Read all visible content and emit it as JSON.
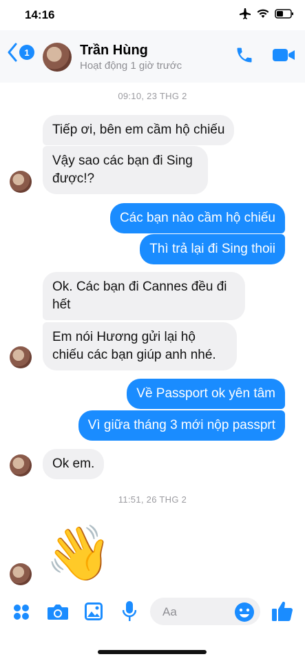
{
  "status": {
    "time": "14:16"
  },
  "header": {
    "back_count": "1",
    "name": "Trần Hùng",
    "presence": "Hoạt động 1 giờ trước"
  },
  "timestamps": [
    "09:10, 23 THG 2",
    "11:51, 26 THG 2"
  ],
  "messages": [
    {
      "dir": "in",
      "text": "Tiếp ơi, bên em cầm hộ chiếu"
    },
    {
      "dir": "in",
      "text": "Vậy sao các bạn đi Sing được!?"
    },
    {
      "dir": "out",
      "text": "Các bạn nào cầm hộ chiếu"
    },
    {
      "dir": "out",
      "text": "Thì trả lại đi Sing thoii"
    },
    {
      "dir": "in",
      "text": "Ok. Các bạn đi Cannes đều đi hết"
    },
    {
      "dir": "in",
      "text": "Em nói Hương gửi lại hộ chiếu các bạn giúp anh nhé."
    },
    {
      "dir": "out",
      "text": "Về Passport ok yên tâm"
    },
    {
      "dir": "out",
      "text": "Vì giữa tháng 3 mới nộp passprt"
    },
    {
      "dir": "in",
      "text": "Ok em."
    },
    {
      "dir": "in",
      "text": "👋"
    }
  ],
  "composer": {
    "placeholder": "Aa"
  },
  "icons": {
    "back": "chevron-left-icon",
    "call": "phone-icon",
    "video": "video-camera-icon",
    "apps": "four-dots-icon",
    "camera": "camera-icon",
    "gallery": "image-icon",
    "mic": "microphone-icon",
    "emoji": "smiley-icon",
    "like": "thumbs-up-icon"
  },
  "colors": {
    "accent": "#1a8cff",
    "incoming_bubble": "#f0f0f2"
  }
}
